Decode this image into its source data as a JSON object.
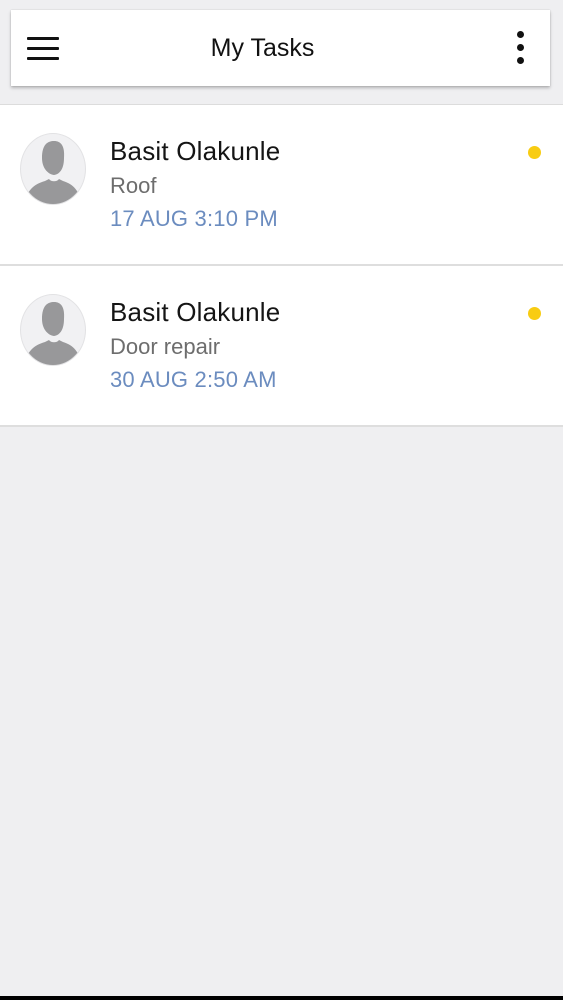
{
  "header": {
    "title": "My Tasks",
    "menu_icon": "hamburger-menu-icon",
    "more_icon": "more-vertical-icon"
  },
  "tasks": [
    {
      "name": "Basit Olakunle",
      "title": "Roof",
      "date": "17 AUG 3:10 PM",
      "avatar_icon": "user-placeholder-icon",
      "status_color": "#f8cc12"
    },
    {
      "name": "Basit Olakunle",
      "title": "Door repair",
      "date": "30 AUG 2:50 AM",
      "avatar_icon": "user-placeholder-icon",
      "status_color": "#f8cc12"
    }
  ],
  "colors": {
    "background": "#efeff1",
    "date_text": "#6b8cbf",
    "status_dot": "#f8cc12"
  }
}
